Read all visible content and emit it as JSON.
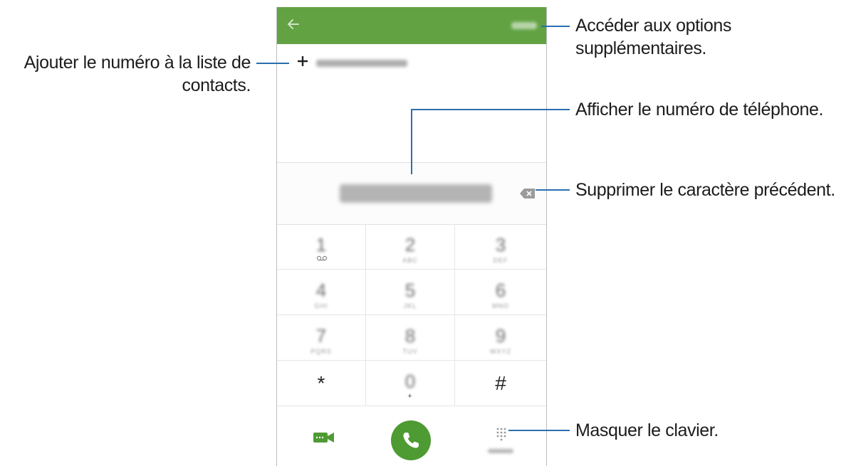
{
  "callouts": {
    "options": [
      "Accéder aux options",
      "supplémentaires."
    ],
    "add_contact": [
      "Ajouter le numéro à la liste de",
      "contacts."
    ],
    "display_number": "Afficher le numéro de téléphone.",
    "delete_char": "Supprimer le caractère précédent.",
    "hide_keypad": "Masquer le clavier."
  },
  "keypad": {
    "keys": [
      {
        "digit": "1",
        "letters": ""
      },
      {
        "digit": "2",
        "letters": "ABC"
      },
      {
        "digit": "3",
        "letters": "DEF"
      },
      {
        "digit": "4",
        "letters": "GHI"
      },
      {
        "digit": "5",
        "letters": "JKL"
      },
      {
        "digit": "6",
        "letters": "MNO"
      },
      {
        "digit": "7",
        "letters": "PQRS"
      },
      {
        "digit": "8",
        "letters": "TUV"
      },
      {
        "digit": "9",
        "letters": "WXYZ"
      },
      {
        "digit": "*",
        "letters": ""
      },
      {
        "digit": "0",
        "letters": "+"
      },
      {
        "digit": "#",
        "letters": ""
      }
    ]
  },
  "colors": {
    "appbar": "#62a243",
    "call_button": "#4e9a33",
    "leader_line": "#2a6fb0"
  },
  "icons": {
    "back": "back-arrow-icon",
    "more": "more-icon",
    "add": "plus-icon",
    "backspace": "backspace-icon",
    "voicemail": "voicemail-icon",
    "video": "video-call-icon",
    "call": "phone-icon",
    "keypad": "keypad-icon"
  }
}
